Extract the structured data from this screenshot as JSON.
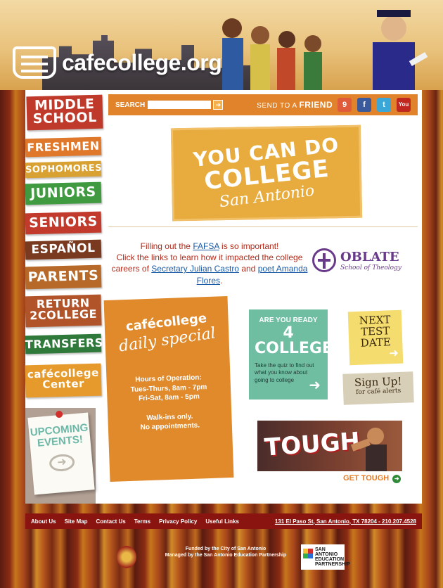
{
  "header": {
    "logo_text": "cafecollege.org"
  },
  "sidebar": {
    "items": [
      {
        "label": "MIDDLE SCHOOL",
        "color": "#c03a2c"
      },
      {
        "label": "FRESHMEN",
        "color": "#e0782c"
      },
      {
        "label": "SOPHOMORES",
        "color": "#d9a032"
      },
      {
        "label": "JUNIORS",
        "color": "#3f9a40"
      },
      {
        "label": "SENIORS",
        "color": "#c23a2c"
      },
      {
        "label": "ESPAÑOL",
        "color": "#7a3a20"
      },
      {
        "label": "PARENTS",
        "color": "#b7692a"
      },
      {
        "label": "RETURN 2COLLEGE",
        "color": "#b2542a"
      },
      {
        "label": "TRANSFERS",
        "color": "#2f7a3a"
      },
      {
        "label": "cafécollege Center",
        "color": "#e69a2c"
      }
    ],
    "events_label": "UPCOMING EVENTS!"
  },
  "toolbar": {
    "search_label": "SEARCH",
    "search_value": "",
    "send_prefix": "SEND TO A",
    "send_suffix": "FRIEND",
    "social": [
      {
        "name": "calendar-icon",
        "glyph": "9",
        "color": "#e05b3a"
      },
      {
        "name": "facebook-icon",
        "glyph": "f",
        "color": "#3a5a9c"
      },
      {
        "name": "twitter-icon",
        "glyph": "t",
        "color": "#3aa7d8"
      },
      {
        "name": "youtube-icon",
        "glyph": "You",
        "color": "#c0281f"
      }
    ]
  },
  "hero": {
    "line1": "YOU CAN DO",
    "line2": "COLLEGE",
    "line3": "San Antonio"
  },
  "fafsa": {
    "p1_before": "Filling out the ",
    "p1_link": "FAFSA",
    "p1_after": " is so important!",
    "p2": "Click the links to learn how it impacted the college careers of ",
    "link_castro": "Secretary Julian Castro",
    "and": " and ",
    "link_flores": "poet Amanda Flores",
    "end": "."
  },
  "oblate": {
    "name": "OBLATE",
    "sub": "School of Theology"
  },
  "special": {
    "brand": "cafécollege",
    "sub": "daily special",
    "hours_title": "Hours of Operation:",
    "hours_1": "Tues-Thurs, 8am - 7pm",
    "hours_2": "Fri-Sat, 8am - 5pm",
    "walk_1": "Walk-ins only.",
    "walk_2": "No appointments."
  },
  "quiz": {
    "line1": "ARE YOU READY",
    "line2": "4 COLLEGE",
    "body": "Take the quiz to find out what you know about going to college"
  },
  "next_test": {
    "l1": "NEXT",
    "l2": "TEST",
    "l3": "DATE"
  },
  "signup": {
    "l1": "Sign Up!",
    "l2": "for café alerts"
  },
  "tough": {
    "word": "TOUGH",
    "link": "GET TOUGH"
  },
  "footer": {
    "links": [
      "About Us",
      "Site Map",
      "Contact Us",
      "Terms",
      "Privacy Policy",
      "Useful Links"
    ],
    "address": "131 El Paso St, San Antonio, TX 78204 - 210.207.4528",
    "funded_1": "Funded by the City of San Antonio",
    "funded_2": "Managed by the San Antonio Education Partnership",
    "saep": "SAN ANTONIO EDUCATION PARTNERSHIP"
  }
}
